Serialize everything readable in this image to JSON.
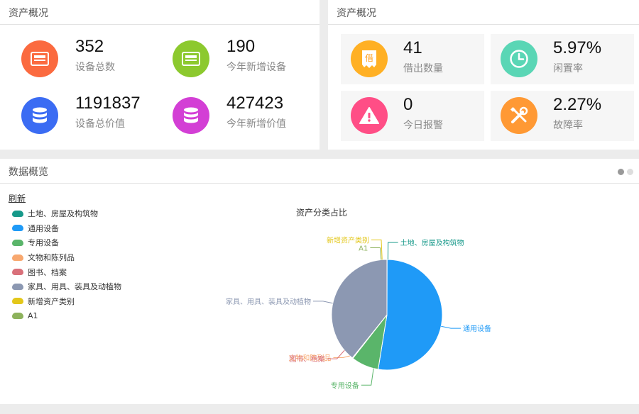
{
  "overview_left": {
    "title": "资产概况",
    "stats": [
      {
        "value": "352",
        "label": "设备总数",
        "color": "#fb6a3f",
        "icon": "device-box-icon"
      },
      {
        "value": "190",
        "label": "今年新增设备",
        "color": "#8cc92e",
        "icon": "device-box-icon"
      },
      {
        "value": "1191837",
        "label": "设备总价值",
        "color": "#3b6cf3",
        "icon": "database-icon"
      },
      {
        "value": "427423",
        "label": "今年新增价值",
        "color": "#d33fd5",
        "icon": "database-icon"
      }
    ]
  },
  "overview_right": {
    "title": "资产概况",
    "cards": [
      {
        "value": "41",
        "label": "借出数量",
        "color": "#ffb024",
        "icon": "borrow-tag-icon",
        "glyph": "借"
      },
      {
        "value": "5.97%",
        "label": "闲置率",
        "color": "#5ad6b5",
        "icon": "clock-icon"
      },
      {
        "value": "0",
        "label": "今日报警",
        "color": "#ff4e86",
        "icon": "warning-icon"
      },
      {
        "value": "2.27%",
        "label": "故障率",
        "color": "#ff9934",
        "icon": "tools-icon"
      }
    ]
  },
  "data_overview": {
    "title": "数据概览",
    "refresh_label": "刷新",
    "dots": [
      {
        "color": "#999999"
      },
      {
        "color": "#dddddd"
      }
    ]
  },
  "chart_data": {
    "type": "pie",
    "title": "资产分类占比",
    "categories": [
      "土地、房屋及构筑物",
      "通用设备",
      "专用设备",
      "文物和陈列品",
      "图书、档案",
      "家具、用具、装具及动植物",
      "新增资产类别",
      "A1"
    ],
    "values": [
      0.05,
      52.5,
      8.0,
      0.1,
      0.1,
      39.25,
      0.0,
      0.0
    ],
    "colors": [
      "#17998a",
      "#1f9af7",
      "#5ab56a",
      "#f8a86f",
      "#d9707a",
      "#8c98b2",
      "#e3c71a",
      "#8db25c"
    ],
    "legend_position": "left"
  }
}
